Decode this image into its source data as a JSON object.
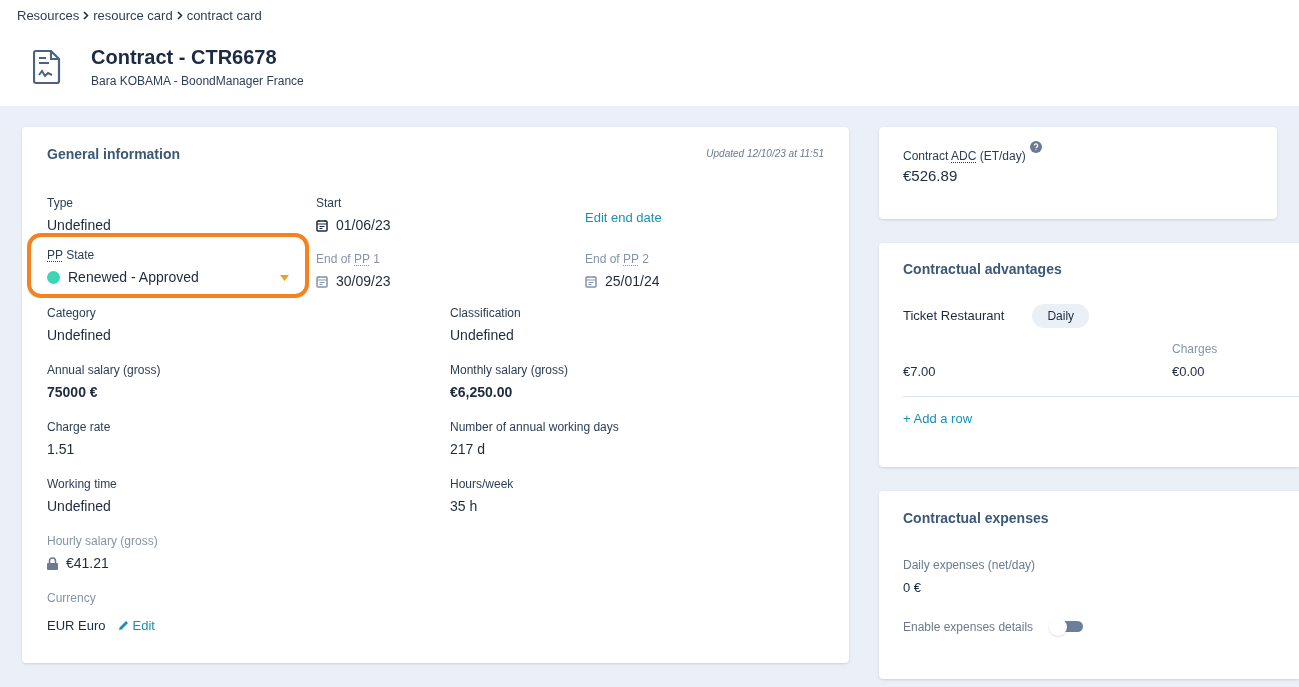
{
  "breadcrumb": [
    {
      "label": "Resources"
    },
    {
      "label": "resource card"
    },
    {
      "label": "contract card"
    }
  ],
  "header": {
    "title": "Contract - CTR6678",
    "subtitle": "Bara KOBAMA - BoondManager France"
  },
  "general": {
    "title": "General information",
    "updated": "Updated 12/10/23 at 11:51",
    "top_rows": [
      [
        {
          "kind": "text",
          "label": "Type",
          "value": "Undefined",
          "emphasis": false
        },
        {
          "kind": "date",
          "label": "Start",
          "value": "01/06/23",
          "disabled": false
        },
        {
          "kind": "link",
          "value": "Edit end date"
        }
      ],
      [
        {
          "kind": "select",
          "label_parts": [
            {
              "text": "PP",
              "abbr": true
            },
            {
              "text": " State",
              "abbr": false
            }
          ],
          "value": "Renewed - Approved",
          "color": "#3dd6b5"
        },
        {
          "kind": "date",
          "label_parts": [
            {
              "text": "End of ",
              "abbr": false
            },
            {
              "text": "PP",
              "abbr": true
            },
            {
              "text": " 1",
              "abbr": false
            }
          ],
          "value": "30/09/23",
          "disabled": true
        },
        {
          "kind": "date",
          "label_parts": [
            {
              "text": "End of ",
              "abbr": false
            },
            {
              "text": "PP",
              "abbr": true
            },
            {
              "text": " 2",
              "abbr": false
            }
          ],
          "value": "25/01/24",
          "disabled": true
        }
      ]
    ],
    "rows": [
      [
        {
          "kind": "text",
          "label": "Category",
          "value": "Undefined",
          "emphasis": false
        },
        {
          "kind": "text",
          "label": "Classification",
          "value": "Undefined",
          "emphasis": false
        }
      ],
      [
        {
          "kind": "text",
          "label": "Annual salary (gross)",
          "value": "75000 €",
          "emphasis": true
        },
        {
          "kind": "text",
          "label": "Monthly salary (gross)",
          "value": "€6,250.00",
          "emphasis": true
        }
      ],
      [
        {
          "kind": "text",
          "label": "Charge rate",
          "value": "1.51",
          "emphasis": false
        },
        {
          "kind": "text",
          "label": "Number of annual working days",
          "value": "217 d",
          "emphasis": false
        }
      ],
      [
        {
          "kind": "text",
          "label": "Working time",
          "value": "Undefined",
          "emphasis": false
        },
        {
          "kind": "text",
          "label": "Hours/week",
          "value": "35 h",
          "emphasis": false
        }
      ],
      [
        {
          "kind": "locked",
          "label": "Hourly salary (gross)",
          "value": "€41.21"
        }
      ],
      [
        {
          "kind": "currency",
          "label": "Currency",
          "value": "EUR Euro",
          "action": "Edit"
        }
      ]
    ]
  },
  "adc": {
    "label_parts": [
      {
        "text": "Contract ",
        "abbr": false
      },
      {
        "text": "ADC",
        "abbr": true
      },
      {
        "text": " (ET/day)",
        "abbr": false
      }
    ],
    "value": "€526.89"
  },
  "advantages": {
    "title": "Contractual advantages",
    "items": [
      {
        "name": "Ticket Restaurant",
        "frequency": "Daily",
        "amount": "€7.00",
        "charges_label": "Charges",
        "charges": "€0.00"
      }
    ],
    "add": "+ Add a row"
  },
  "expenses": {
    "title": "Contractual expenses",
    "label": "Daily expenses (net/day)",
    "value": "0 €",
    "toggle": {
      "label": "Enable expenses details",
      "on": false
    }
  }
}
